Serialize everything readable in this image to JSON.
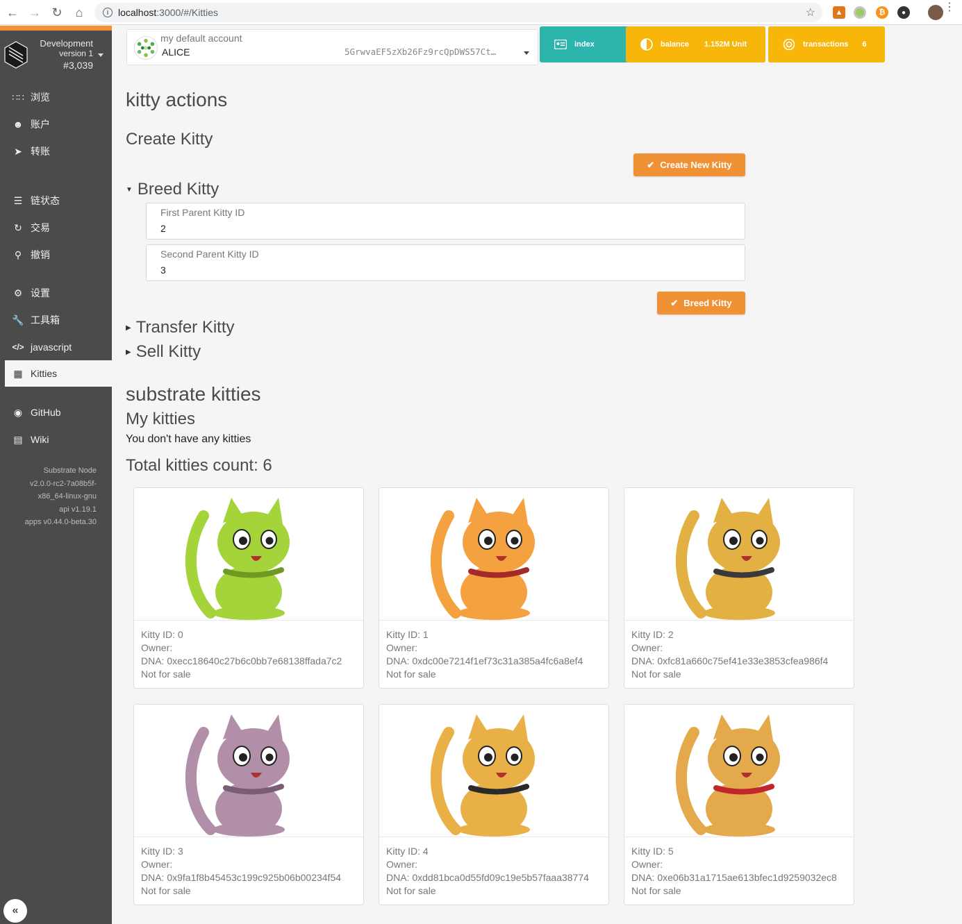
{
  "browser": {
    "url_host": "localhost",
    "url_path": ":3000/#/Kitties"
  },
  "sidebar": {
    "chain_name": "Development",
    "chain_version": "version 1",
    "block": "#3,039",
    "items": [
      {
        "label": "浏览",
        "icon": "grid-dots-icon"
      },
      {
        "label": "账户",
        "icon": "users-icon"
      },
      {
        "label": "转账",
        "icon": "send-icon"
      },
      {
        "label": "链状态",
        "icon": "database-icon"
      },
      {
        "label": "交易",
        "icon": "sync-icon"
      },
      {
        "label": "撤销",
        "icon": "unlock-icon"
      },
      {
        "label": "设置",
        "icon": "settings-icon"
      },
      {
        "label": "工具箱",
        "icon": "wrench-icon"
      },
      {
        "label": "javascript",
        "icon": "code-icon"
      },
      {
        "label": "Kitties",
        "icon": "grid-icon"
      },
      {
        "label": "GitHub",
        "icon": "github-icon"
      },
      {
        "label": "Wiki",
        "icon": "book-icon"
      }
    ],
    "node_info": [
      "Substrate Node",
      "v2.0.0-rc2-7a08b5f-",
      "x86_64-linux-gnu",
      "api v1.19.1",
      "apps v0.44.0-beta.30"
    ]
  },
  "account": {
    "label": "my default account",
    "name": "ALICE",
    "address": "5GrwvaEF5zXb26Fz9rcQpDWS57Ct…"
  },
  "stats": {
    "index_label": "index",
    "balance_label": "balance",
    "balance_value": "1.152M Unit",
    "transactions_label": "transactions",
    "transactions_value": "6"
  },
  "actions": {
    "title": "kitty actions",
    "create_title": "Create Kitty",
    "create_button": "Create New Kitty",
    "breed_title": "Breed Kitty",
    "first_parent_label": "First Parent Kitty ID",
    "first_parent_value": "2",
    "second_parent_label": "Second Parent Kitty ID",
    "second_parent_value": "3",
    "breed_button": "Breed Kitty",
    "transfer_title": "Transfer Kitty",
    "sell_title": "Sell Kitty"
  },
  "kitties": {
    "title": "substrate kitties",
    "mine_title": "My kitties",
    "mine_empty": "You don't have any kitties",
    "total_label": "Total kitties count: 6",
    "list": [
      {
        "id": "Kitty ID: 0",
        "owner": "Owner:",
        "dna": "DNA: 0xecc18640c27b6c0bb7e68138ffada7c2",
        "sale": "Not for sale",
        "color": "#a4d33a",
        "accent": "#6e9a24"
      },
      {
        "id": "Kitty ID: 1",
        "owner": "Owner:",
        "dna": "DNA: 0xdc00e7214f1ef73c31a385a4fc6a8ef4",
        "sale": "Not for sale",
        "color": "#f3a23f",
        "accent": "#a5282b"
      },
      {
        "id": "Kitty ID: 2",
        "owner": "Owner:",
        "dna": "DNA: 0xfc81a660c75ef41e33e3853cfea986f4",
        "sale": "Not for sale",
        "color": "#e3b143",
        "accent": "#3a3a3a"
      },
      {
        "id": "Kitty ID: 3",
        "owner": "Owner:",
        "dna": "DNA: 0x9fa1f8b45453c199c925b06b00234f54",
        "sale": "Not for sale",
        "color": "#b18fa8",
        "accent": "#7a5d74"
      },
      {
        "id": "Kitty ID: 4",
        "owner": "Owner:",
        "dna": "DNA: 0xdd81bca0d55fd09c19e5b57faaa38774",
        "sale": "Not for sale",
        "color": "#e8b046",
        "accent": "#2a2a2a"
      },
      {
        "id": "Kitty ID: 5",
        "owner": "Owner:",
        "dna": "DNA: 0xe06b31a1715ae613bfec1d9259032ec8",
        "sale": "Not for sale",
        "color": "#e3a94a",
        "accent": "#c0272d"
      }
    ]
  }
}
